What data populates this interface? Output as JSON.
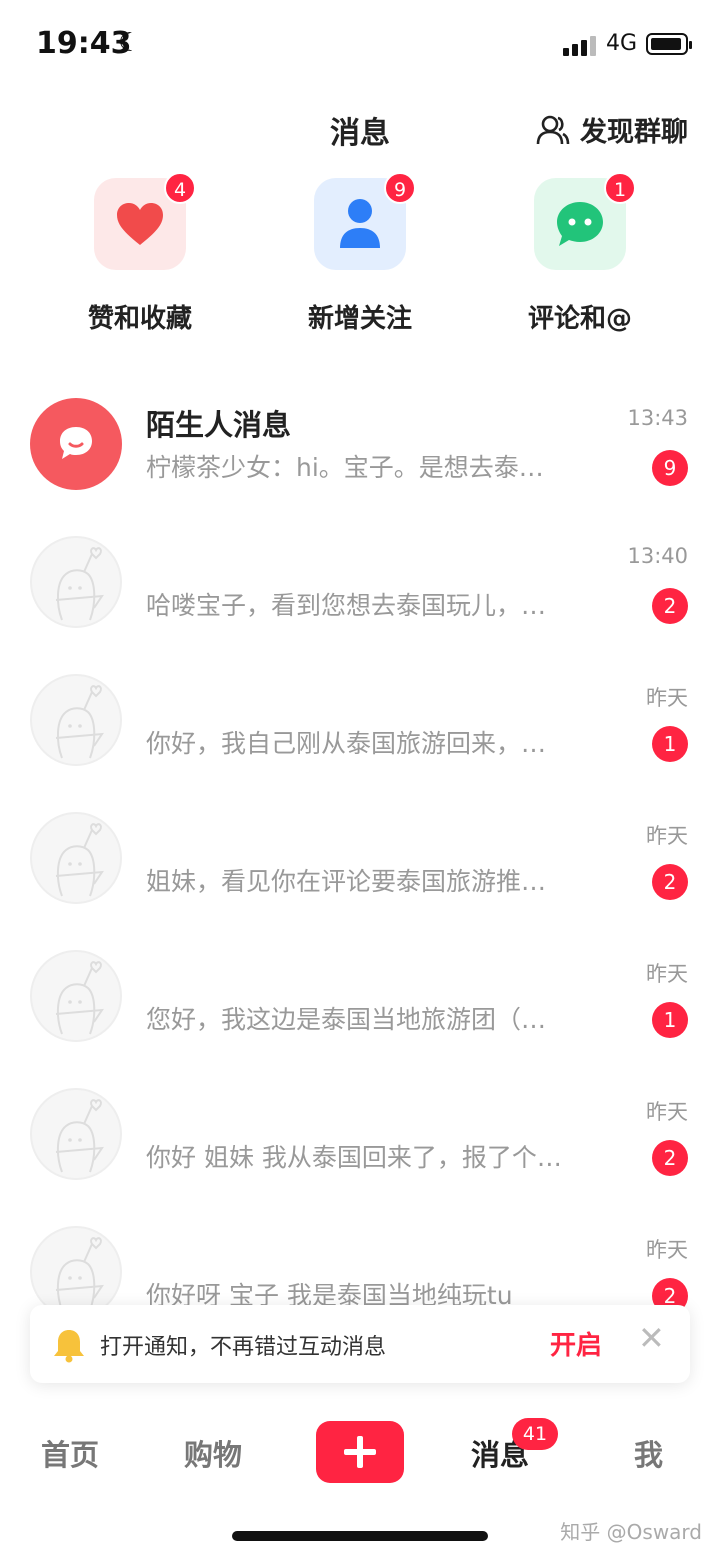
{
  "status_bar": {
    "time": "19:43",
    "network": "4G"
  },
  "header": {
    "title": "消息",
    "discover_label": "发现群聊"
  },
  "categories": [
    {
      "label": "赞和收藏",
      "badge": "4"
    },
    {
      "label": "新增关注",
      "badge": "9"
    },
    {
      "label": "评论和@",
      "badge": "1"
    }
  ],
  "messages": [
    {
      "name": "陌生人消息",
      "preview": "柠檬茶少女：hi。宝子。是想去泰…",
      "time": "13:43",
      "count": "9"
    },
    {
      "name": "",
      "preview": "哈喽宝子，看到您想去泰国玩儿，…",
      "time": "13:40",
      "count": "2"
    },
    {
      "name": "",
      "preview": "你好，我自己刚从泰国旅游回来，…",
      "time": "昨天",
      "count": "1"
    },
    {
      "name": "",
      "preview": "姐妹，看见你在评论要泰国旅游推…",
      "time": "昨天",
      "count": "2"
    },
    {
      "name": "",
      "preview": "您好，我这边是泰国当地旅游团（…",
      "time": "昨天",
      "count": "1"
    },
    {
      "name": "",
      "preview": "你好 姐妹 我从泰国回来了，报了个…",
      "time": "昨天",
      "count": "2"
    },
    {
      "name": "",
      "preview": "你好呀 宝子 我是泰国当地纯玩tu",
      "time": "昨天",
      "count": "2"
    }
  ],
  "notification": {
    "text": "打开通知，不再错过互动消息",
    "action": "开启"
  },
  "tabbar": {
    "home": "首页",
    "shop": "购物",
    "messages": "消息",
    "messages_badge": "41",
    "me": "我"
  },
  "watermark": "知乎 @Osward",
  "colors": {
    "accent": "#ff2442",
    "like_bg": "#fde8e8",
    "follow_bg": "#e3eefe",
    "comment_bg": "#e2f8ec"
  }
}
